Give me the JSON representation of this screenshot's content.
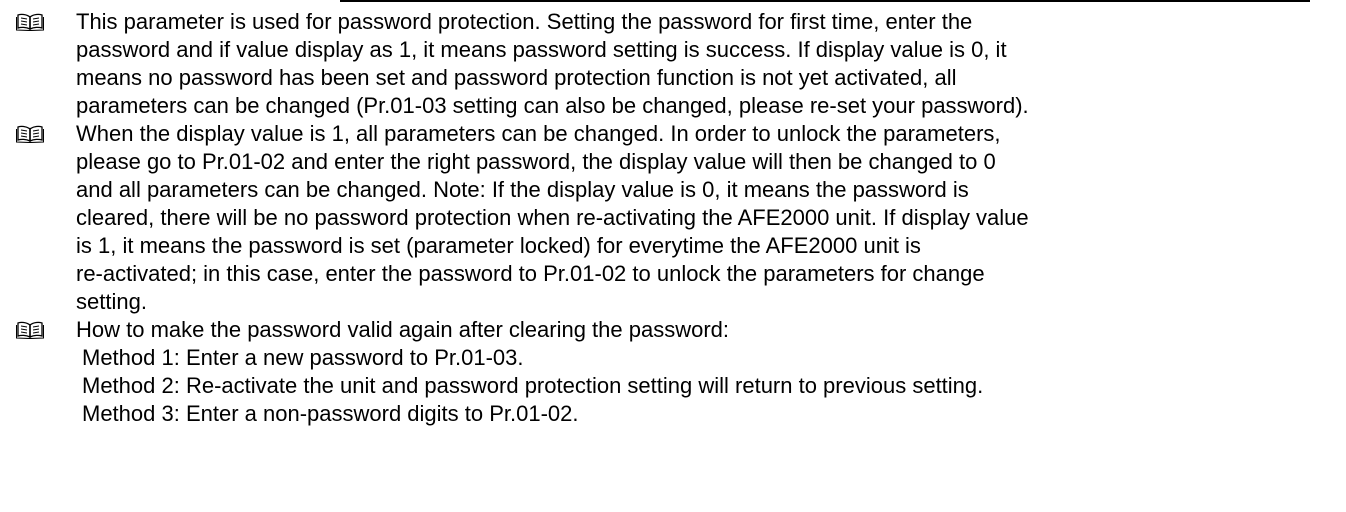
{
  "icon": "open-book-icon",
  "items": [
    {
      "lines": [
        "This parameter is used for password protection. Setting the password for first time, enter the",
        "password and if value display as 1, it means password setting is success. If display value is 0, it",
        "means no password has been set and password protection function is not yet activated, all",
        "parameters can be changed (Pr.01-03 setting can also be changed, please re-set your password)."
      ]
    },
    {
      "lines": [
        "When the display value is 1, all parameters can be changed. In order to unlock the parameters,",
        "please go to Pr.01-02 and enter the right password, the display value will then be changed to 0",
        "and all parameters can be changed. Note: If the display value is 0, it means the password is",
        "cleared, there will be no password protection when re-activating the AFE2000 unit. If display value",
        "is 1, it means the password is set (parameter locked) for everytime the AFE2000 unit is",
        "re-activated; in this case, enter the password to Pr.01-02 to unlock the parameters for change",
        "setting."
      ]
    },
    {
      "lines": [
        "How to make the password valid again after clearing the password:"
      ],
      "methods": [
        "Method 1: Enter a new password to Pr.01-03.",
        "Method 2: Re-activate the unit and password protection setting will return to previous setting.",
        "Method 3: Enter a non-password digits to Pr.01-02."
      ]
    }
  ]
}
